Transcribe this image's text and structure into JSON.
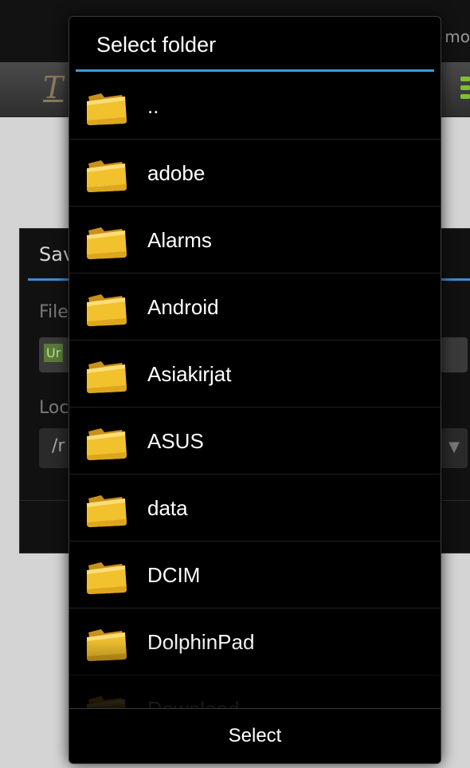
{
  "background": {
    "status_text": "mo",
    "save_dialog": {
      "title": "Sav",
      "filename_label": "File",
      "filename_value": "Ur",
      "location_label": "Loc",
      "location_value": "/r",
      "location_arrow": "▼"
    }
  },
  "folder_dialog": {
    "title": "Select folder",
    "folders": [
      {
        "name": "..",
        "icon": "folder-icon"
      },
      {
        "name": "adobe",
        "icon": "folder-icon"
      },
      {
        "name": "Alarms",
        "icon": "folder-icon"
      },
      {
        "name": "Android",
        "icon": "folder-icon"
      },
      {
        "name": "Asiakirjat",
        "icon": "folder-icon"
      },
      {
        "name": "ASUS",
        "icon": "folder-icon"
      },
      {
        "name": "data",
        "icon": "folder-icon"
      },
      {
        "name": "DCIM",
        "icon": "folder-icon"
      },
      {
        "name": "DolphinPad",
        "icon": "folder-icon"
      },
      {
        "name": "Download",
        "icon": "folder-icon"
      }
    ],
    "select_label": "Select"
  },
  "colors": {
    "accent": "#33a0e0",
    "folder_yellow": "#f2c12e",
    "dialog_background": "#000000"
  }
}
